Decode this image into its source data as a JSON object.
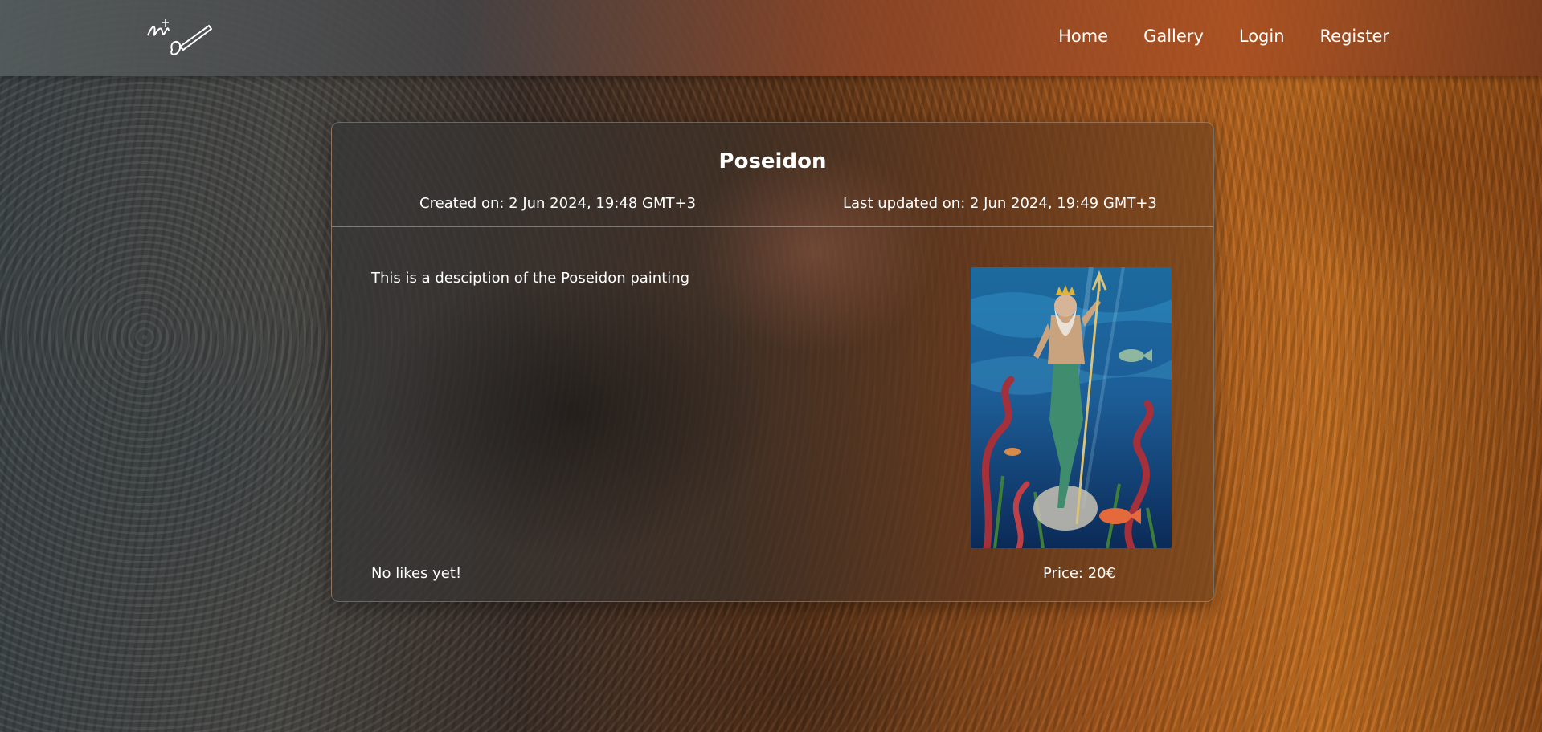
{
  "nav": {
    "logo_alt": "Art logo",
    "links": [
      {
        "label": "Home"
      },
      {
        "label": "Gallery"
      },
      {
        "label": "Login"
      },
      {
        "label": "Register"
      }
    ]
  },
  "painting": {
    "title": "Poseidon",
    "created": "Created on: 2 Jun 2024, 19:48 GMT+3",
    "updated": "Last updated on: 2 Jun 2024, 19:49 GMT+3",
    "description": "This is a desciption of the Poseidon painting",
    "likes": "No likes yet!",
    "price": "Price: 20€",
    "image_label": "Poseidon painting"
  },
  "colors": {
    "text": "#ffffff",
    "sea_deep": "#0b3a6e",
    "sea_light": "#2f8fc9",
    "figure": "#c9a27e",
    "tentacle": "#a3303a",
    "seaweed": "#3e7d3a"
  }
}
